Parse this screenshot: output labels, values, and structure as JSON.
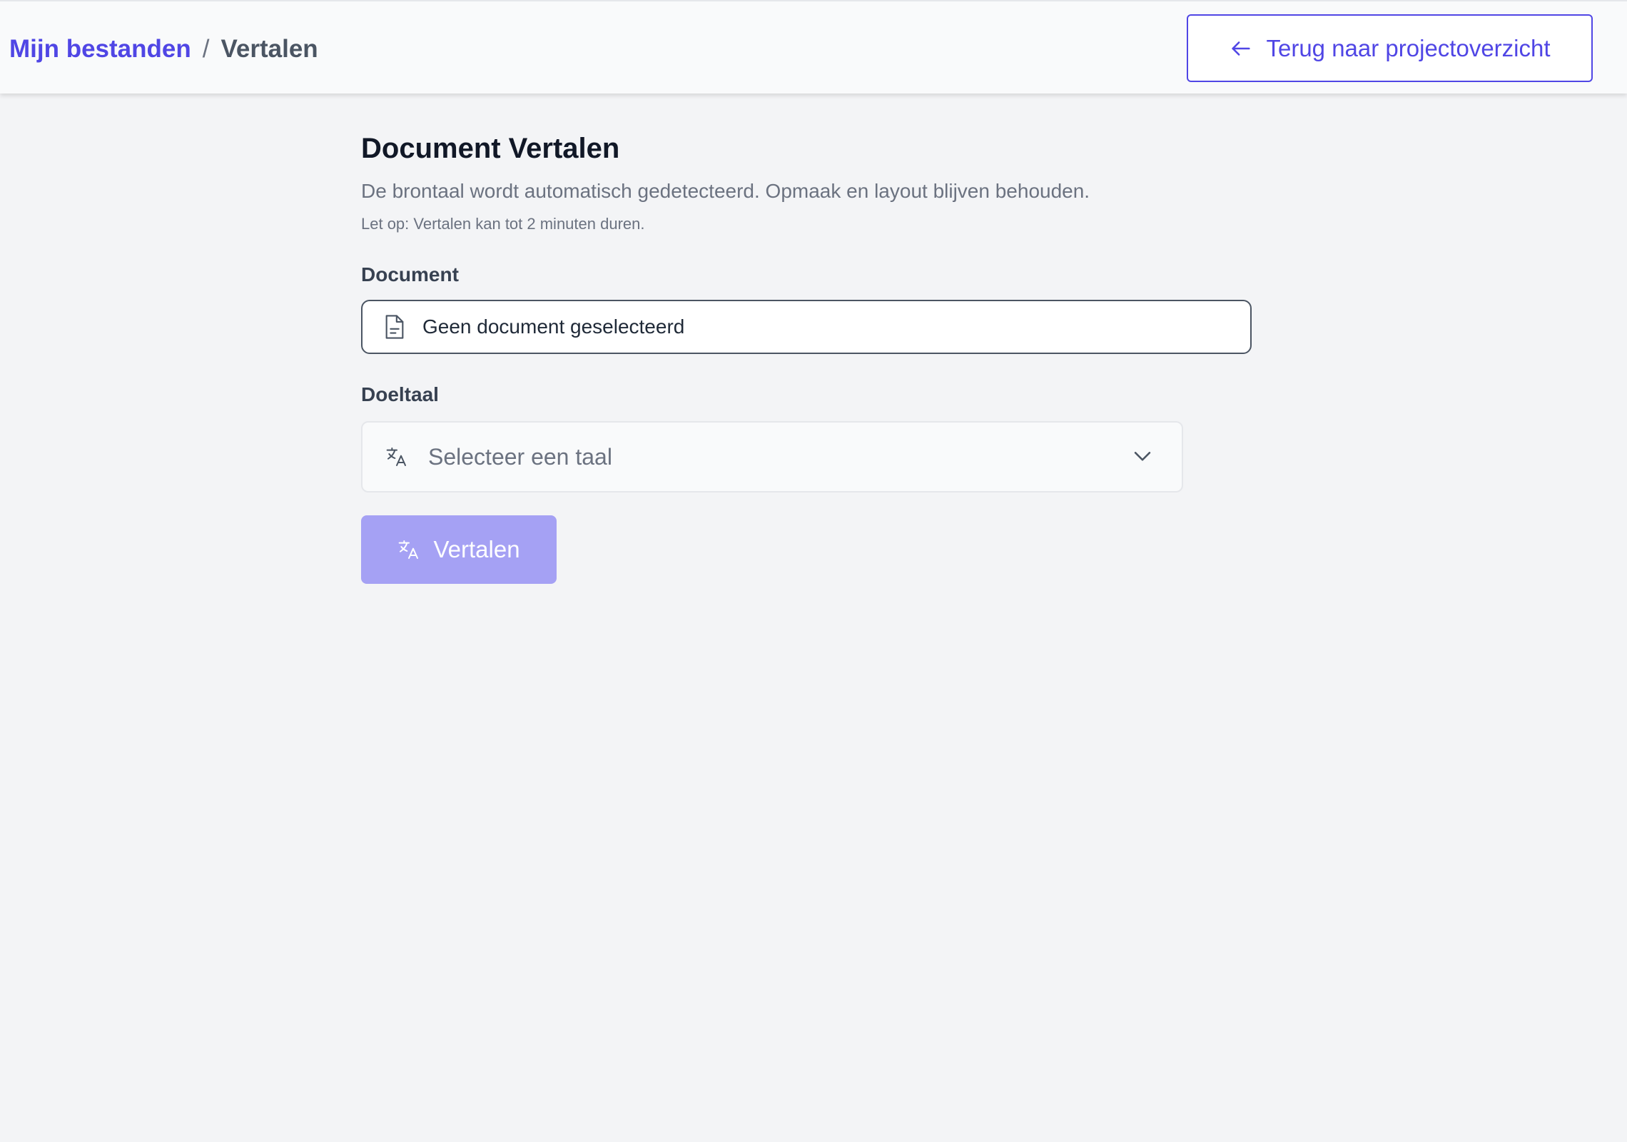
{
  "header": {
    "breadcrumb": {
      "root": "Mijn bestanden",
      "separator": "/",
      "current": "Vertalen"
    },
    "back_button_label": "Terug naar projectoverzicht",
    "back_icon": "arrow-left-icon"
  },
  "main": {
    "title": "Document Vertalen",
    "subtitle": "De brontaal wordt automatisch gedetecteerd. Opmaak en layout blijven behouden.",
    "note": "Let op: Vertalen kan tot 2 minuten duren.",
    "document_field": {
      "label": "Document",
      "value": "Geen document geselecteerd",
      "icon": "file-icon"
    },
    "target_language": {
      "label": "Doeltaal",
      "placeholder": "Selecteer een taal",
      "icon": "translate-icon",
      "dropdown_icon": "chevron-down-icon"
    },
    "translate_button": {
      "label": "Vertalen",
      "icon": "translate-icon",
      "disabled": true
    }
  },
  "colors": {
    "accent": "#5046e5",
    "accent_disabled": "#a5a1f4",
    "background": "#f3f4f6",
    "header_bg": "#f9fafb"
  }
}
